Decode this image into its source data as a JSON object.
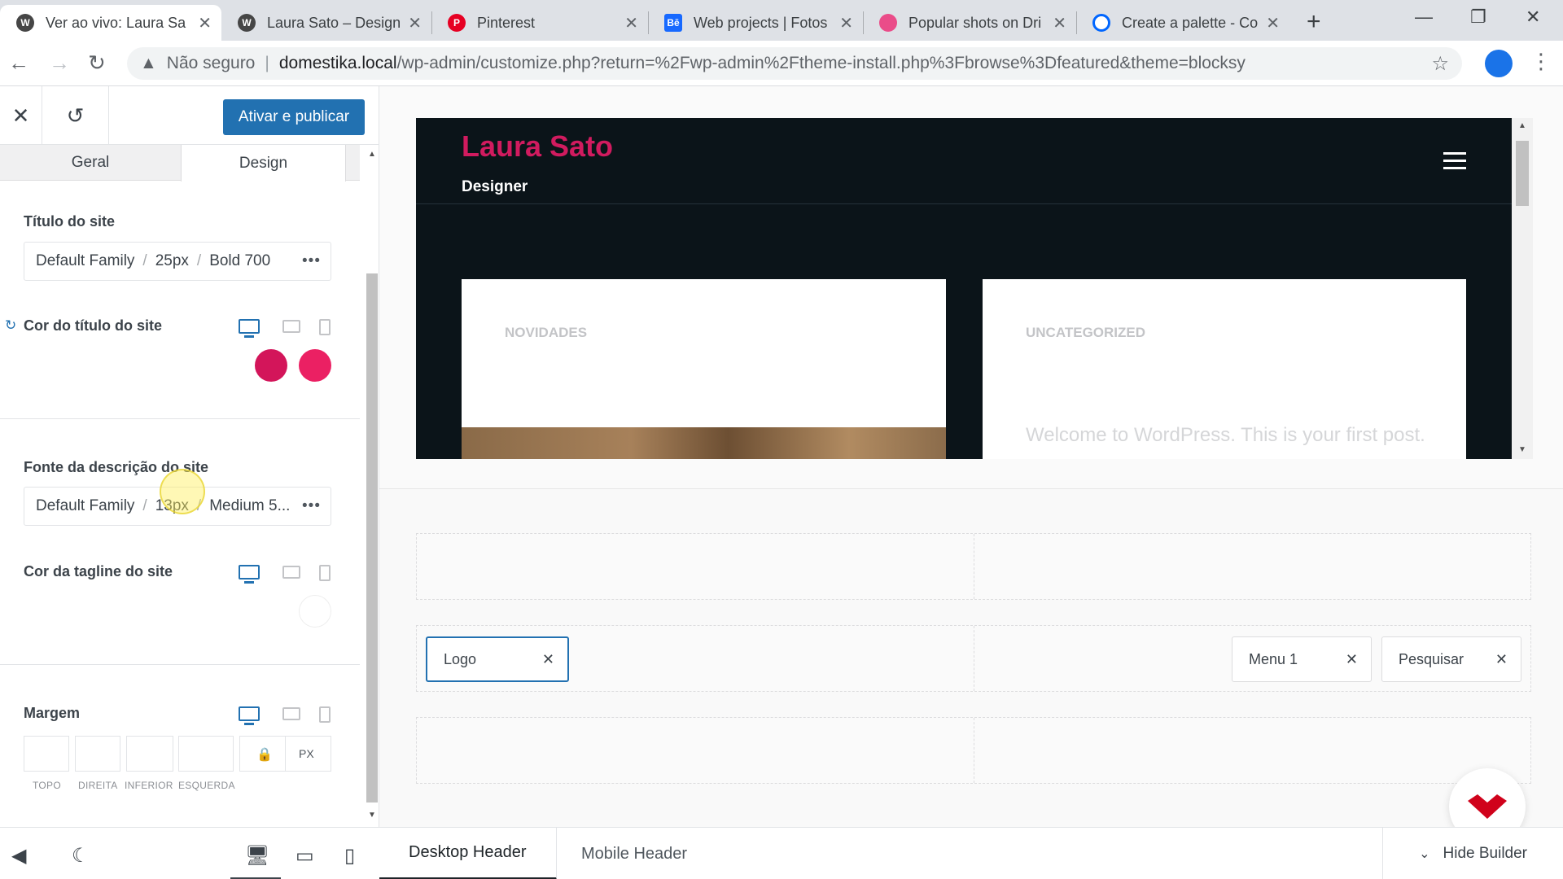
{
  "browser": {
    "tabs": [
      {
        "title": "Ver ao vivo: Laura Sa",
        "icon": "wordpress-icon",
        "active": true
      },
      {
        "title": "Laura Sato – Designe",
        "icon": "wordpress-icon"
      },
      {
        "title": "Pinterest",
        "icon": "pinterest-icon"
      },
      {
        "title": "Web projects | Fotos",
        "icon": "behance-icon"
      },
      {
        "title": "Popular shots on Dri",
        "icon": "dribbble-icon"
      },
      {
        "title": "Create a palette - Co",
        "icon": "coolors-icon"
      }
    ],
    "url_warning": "Não seguro",
    "url_host": "domestika.local",
    "url_path": "/wp-admin/customize.php?return=%2Fwp-admin%2Ftheme-install.php%3Fbrowse%3Dfeatured&theme=blocksy",
    "colors": {
      "accent": "#1a73e8"
    }
  },
  "customizer": {
    "publish_label": "Ativar e publicar",
    "tabs": [
      "Geral",
      "Design"
    ],
    "active_tab": "Design",
    "site_title_label": "Título do site",
    "site_title_typo": {
      "family": "Default Family",
      "size": "25px",
      "weight": "Bold 700"
    },
    "title_color_label": "Cor do título do site",
    "title_colors": [
      "#d3155a",
      "#eb2063"
    ],
    "desc_font_label": "Fonte da descrição do site",
    "desc_typo": {
      "family": "Default Family",
      "size": "13px",
      "weight": "Medium 5..."
    },
    "tagline_color_label": "Cor da tagline do site",
    "tagline_color": "#ffffff",
    "margin_label": "Margem",
    "margin_unit": "PX",
    "margin_sides": [
      "TOPO",
      "DIREITA",
      "INFERIOR",
      "ESQUERDA"
    ],
    "colors": {
      "accent": "#2271b1"
    }
  },
  "preview": {
    "site_title": "Laura Sato",
    "site_tagline": "Designer",
    "cards": [
      {
        "category": "NOVIDADES",
        "excerpt": ""
      },
      {
        "category": "UNCATEGORIZED",
        "excerpt": "Welcome to WordPress. This is your first post."
      }
    ],
    "colors": {
      "background": "#0b1419",
      "title": "#d11b5f"
    }
  },
  "builder": {
    "items": {
      "logo": "Logo",
      "menu": "Menu 1",
      "search": "Pesquisar"
    },
    "footer_tabs": [
      "Desktop Header",
      "Mobile Header"
    ],
    "active_footer_tab": "Desktop Header",
    "hide_label": "Hide Builder"
  }
}
